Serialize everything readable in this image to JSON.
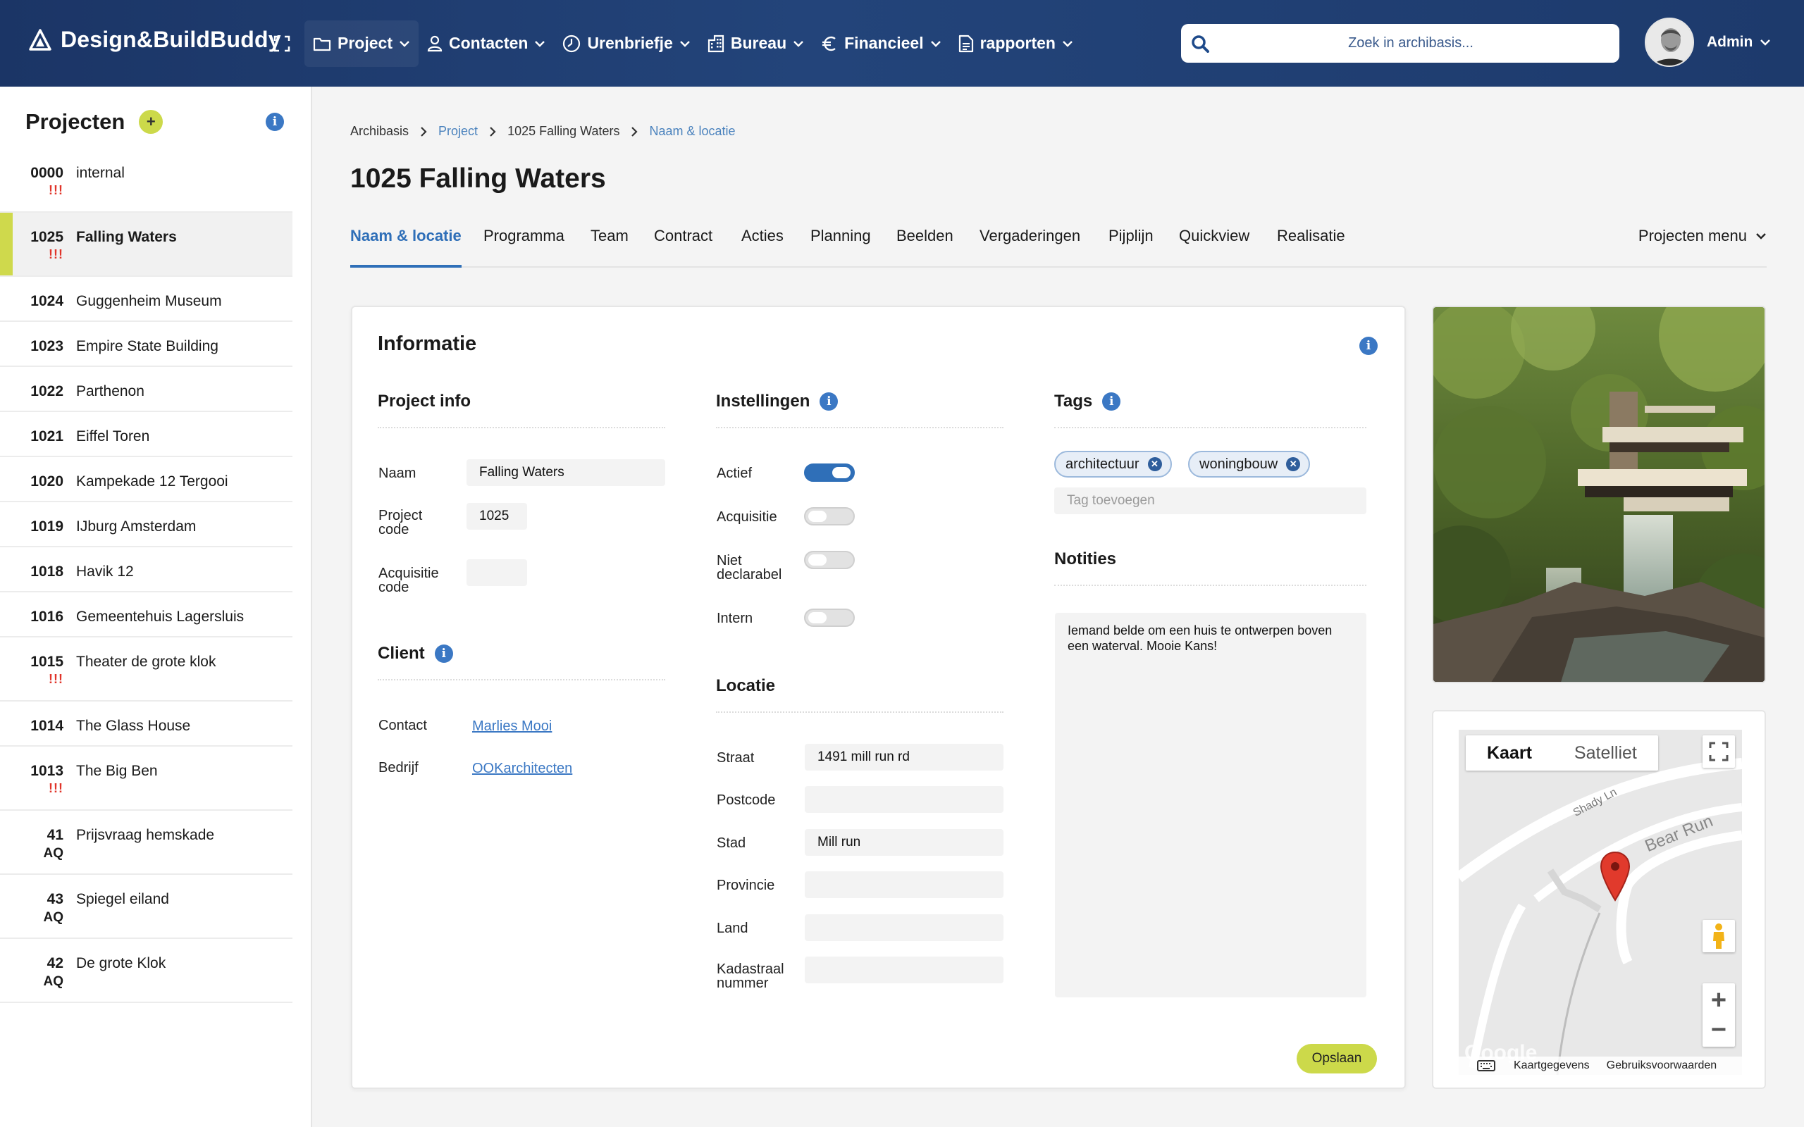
{
  "app": {
    "name": "Design&BuildBuddy"
  },
  "nav": [
    {
      "label": "Project",
      "icon": "folder-icon"
    },
    {
      "label": "Contacten",
      "icon": "person-icon"
    },
    {
      "label": "Urenbriefje",
      "icon": "clock-icon"
    },
    {
      "label": "Bureau",
      "icon": "building-icon"
    },
    {
      "label": "Financieel",
      "icon": "euro-icon"
    },
    {
      "label": "rapporten",
      "icon": "document-icon"
    }
  ],
  "search": {
    "placeholder": "Zoek in archibasis..."
  },
  "user": {
    "name": "Admin"
  },
  "sidebar": {
    "title": "Projecten",
    "add_label": "+",
    "projects": [
      {
        "code": "0000",
        "name": "internal",
        "flag": "!!!",
        "sub": ""
      },
      {
        "code": "1025",
        "name": "Falling Waters",
        "flag": "!!!",
        "sub": ""
      },
      {
        "code": "1024",
        "name": "Guggenheim Museum",
        "flag": "",
        "sub": ""
      },
      {
        "code": "1023",
        "name": "Empire State Building",
        "flag": "",
        "sub": ""
      },
      {
        "code": "1022",
        "name": "Parthenon",
        "flag": "",
        "sub": ""
      },
      {
        "code": "1021",
        "name": "Eiffel Toren",
        "flag": "",
        "sub": ""
      },
      {
        "code": "1020",
        "name": "Kampekade 12 Tergooi",
        "flag": "",
        "sub": ""
      },
      {
        "code": "1019",
        "name": "IJburg Amsterdam",
        "flag": "",
        "sub": ""
      },
      {
        "code": "1018",
        "name": "Havik 12",
        "flag": "",
        "sub": ""
      },
      {
        "code": "1016",
        "name": "Gemeentehuis Lagersluis",
        "flag": "",
        "sub": ""
      },
      {
        "code": "1015",
        "name": "Theater de grote klok",
        "flag": "!!!",
        "sub": ""
      },
      {
        "code": "1014",
        "name": "The Glass House",
        "flag": "",
        "sub": ""
      },
      {
        "code": "1013",
        "name": "The Big Ben",
        "flag": "!!!",
        "sub": ""
      },
      {
        "code": "41",
        "name": "Prijsvraag hemskade",
        "flag": "",
        "sub": "AQ"
      },
      {
        "code": "43",
        "name": "Spiegel eiland",
        "flag": "",
        "sub": "AQ"
      },
      {
        "code": "42",
        "name": "De grote Klok",
        "flag": "",
        "sub": "AQ"
      }
    ]
  },
  "breadcrumb": [
    "Archibasis",
    "Project",
    "1025 Falling Waters",
    "Naam & locatie"
  ],
  "page_title": "1025 Falling Waters",
  "tabs": [
    "Naam & locatie",
    "Programma",
    "Team",
    "Contract",
    "Acties",
    "Planning",
    "Beelden",
    "Vergaderingen",
    "Pijplijn",
    "Quickview",
    "Realisatie"
  ],
  "projects_menu": "Projecten menu",
  "card": {
    "title": "Informatie",
    "project_info": {
      "title": "Project info",
      "naam_label": "Naam",
      "naam_value": "Falling Waters",
      "code_label_1": "Project",
      "code_label_2": "code",
      "code_value": "1025",
      "acq_label_1": "Acquisitie",
      "acq_label_2": "code",
      "acq_value": ""
    },
    "client": {
      "title": "Client",
      "contact_label": "Contact",
      "contact_value": "Marlies Mooi",
      "bedrijf_label": "Bedrijf",
      "bedrijf_value": "OOKarchitecten"
    },
    "instellingen": {
      "title": "Instellingen",
      "actief": "Actief",
      "acquisitie": "Acquisitie",
      "niet_1": "Niet",
      "niet_2": "declarabel",
      "intern": "Intern",
      "actief_on": true,
      "acquisitie_on": false,
      "niet_on": false,
      "intern_on": false
    },
    "locatie": {
      "title": "Locatie",
      "straat_label": "Straat",
      "straat_value": "1491 mill run rd",
      "postcode_label": "Postcode",
      "postcode_value": "",
      "stad_label": "Stad",
      "stad_value": "Mill run",
      "provincie_label": "Provincie",
      "provincie_value": "",
      "land_label": "Land",
      "land_value": "",
      "kad_label_1": "Kadastraal",
      "kad_label_2": "nummer",
      "kad_value": ""
    },
    "tags": {
      "title": "Tags",
      "items": [
        "architectuur",
        "woningbouw"
      ],
      "placeholder": "Tag toevoegen"
    },
    "notities": {
      "title": "Notities",
      "text": "Iemand belde om een huis te ontwerpen boven een waterval. Mooie Kans!"
    },
    "save_label": "Opslaan"
  },
  "map": {
    "map_label": "Kaart",
    "satellite_label": "Satelliet",
    "road_1": "Shady Ln",
    "road_2": "Bear Run",
    "google": "Google",
    "kaartgegevens": "Kaartgegevens",
    "voorwaarden": "Gebruiksvoorwaarden"
  },
  "colors": {
    "accent": "#2f6fb8",
    "lime": "#ccd94a",
    "header": "#1b3566",
    "warning": "#e0342a"
  }
}
